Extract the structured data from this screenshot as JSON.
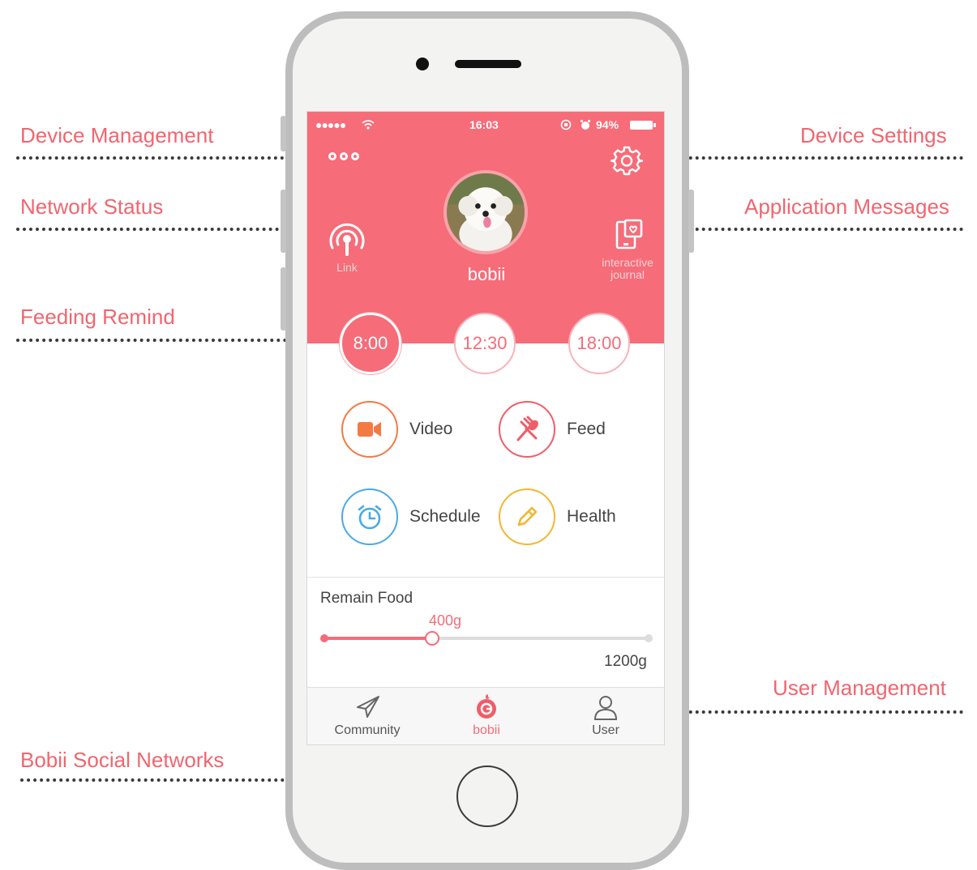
{
  "annotations": {
    "device_management": "Device Management",
    "network_status": "Network Status",
    "feeding_remind": "Feeding Remind",
    "bobii_social_networks": "Bobii Social Networks",
    "device_settings": "Device Settings",
    "application_messages": "Application Messages",
    "user_management": "User Management"
  },
  "status_bar": {
    "signal": "●●●●●",
    "time": "16:03",
    "battery": "94%"
  },
  "header": {
    "pet_name": "bobii",
    "link_label": "Link",
    "journal_label": "interactive journal"
  },
  "feeding_times": [
    "8:00",
    "12:30",
    "18:00"
  ],
  "features": {
    "video": "Video",
    "feed": "Feed",
    "schedule": "Schedule",
    "health": "Health"
  },
  "remain_food": {
    "title": "Remain Food",
    "current": "400g",
    "max": "1200g",
    "fraction": 0.333
  },
  "tabs": {
    "community": "Community",
    "bobii": "bobii",
    "user": "User"
  },
  "colors": {
    "accent": "#f66c79",
    "video": "#f47a44",
    "feed": "#f05d69",
    "schedule": "#4aa9e6",
    "health": "#f2b731",
    "annotation": "#f0666f"
  },
  "icons": [
    "ellipsis-menu-icon",
    "gear-icon",
    "wifi-broadcast-icon",
    "journal-icon",
    "video-camera-icon",
    "fork-spoon-icon",
    "alarm-clock-icon",
    "pencil-icon",
    "paper-plane-icon",
    "bobii-logo-icon",
    "user-icon"
  ]
}
